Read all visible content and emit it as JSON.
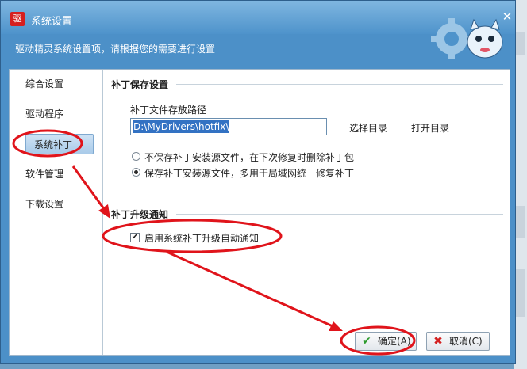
{
  "window": {
    "title": "系统设置",
    "app_icon_text": "驱",
    "close_glyph": "✕",
    "subtitle": "驱动精灵系统设置项，请根据您的需要进行设置"
  },
  "sidebar": {
    "items": [
      {
        "label": "综合设置"
      },
      {
        "label": "驱动程序"
      },
      {
        "label": "系统补丁"
      },
      {
        "label": "软件管理"
      },
      {
        "label": "下载设置"
      }
    ]
  },
  "patch_save": {
    "section_title": "补丁保存设置",
    "path_label": "补丁文件存放路径",
    "path_value": "D:\\MyDrivers\\hotfix\\",
    "choose_dir": "选择目录",
    "open_dir": "打开目录",
    "options": [
      {
        "label": "不保存补丁安装源文件，在下次修复时删除补丁包",
        "selected": false
      },
      {
        "label": "保存补丁安装源文件，多用于局域网统一修复补丁",
        "selected": true
      }
    ]
  },
  "patch_notify": {
    "section_title": "补丁升级通知",
    "checkbox_label": "启用系统补丁升级自动通知",
    "checked": true
  },
  "footer": {
    "ok_label": "确定(A)",
    "cancel_label": "取消(C)"
  },
  "colors": {
    "annotation": "#e0141b",
    "ok_icon": "#2e9b2e",
    "cancel_icon": "#d42020"
  }
}
